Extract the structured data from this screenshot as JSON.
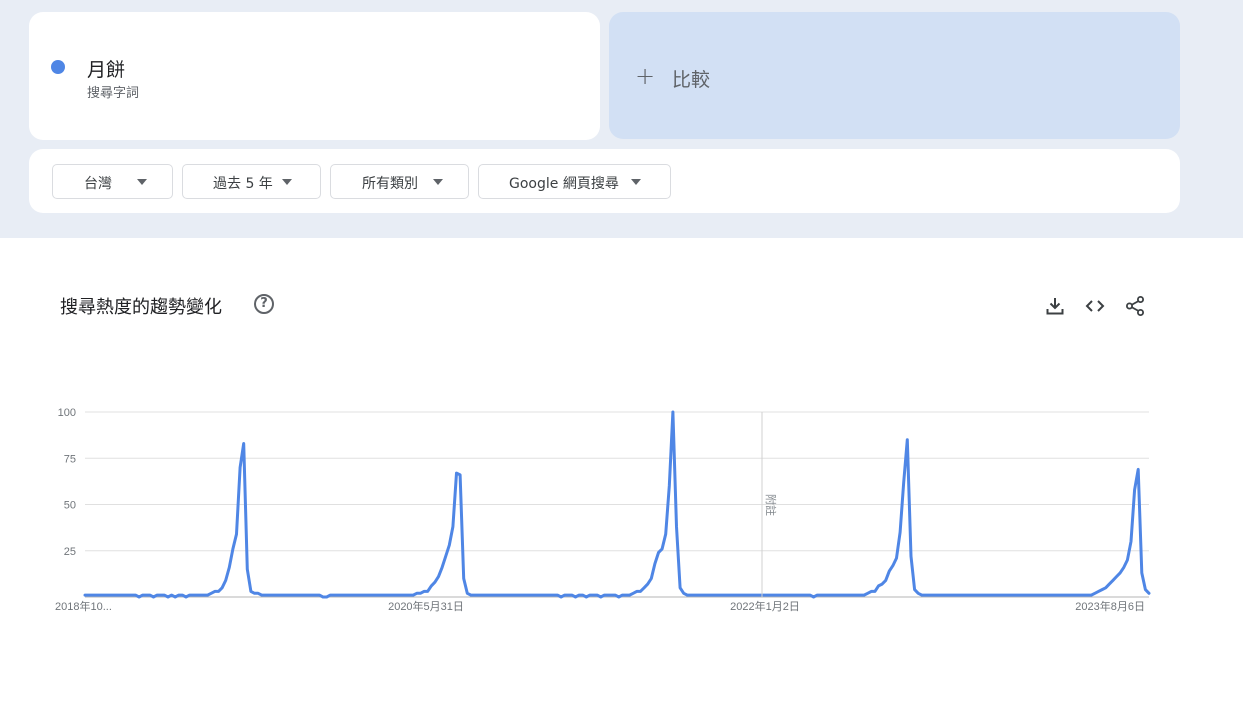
{
  "search_term": {
    "name": "月餅",
    "type": "搜尋字詞",
    "color": "#4f86e5"
  },
  "compare": {
    "label": "比較",
    "bg_color": "#d2e0f4"
  },
  "filters": [
    {
      "label": "台灣"
    },
    {
      "label": "過去 5 年"
    },
    {
      "label": "所有類別"
    },
    {
      "label": "Google 網頁搜尋"
    }
  ],
  "chart_section": {
    "title": "搜尋熱度的趨勢變化",
    "help_icon": "help-circle-icon",
    "actions": [
      "download-icon",
      "embed-code-icon",
      "share-icon"
    ]
  },
  "chart_data": {
    "type": "line",
    "series": [
      {
        "color": "#4f86e5",
        "values": [
          1,
          1,
          1,
          1,
          1,
          1,
          1,
          1,
          1,
          1,
          1,
          1,
          1,
          1,
          1,
          0,
          1,
          1,
          1,
          0,
          1,
          1,
          1,
          0,
          1,
          0,
          1,
          1,
          0,
          1,
          1,
          1,
          1,
          1,
          1,
          2,
          3,
          3,
          5,
          9,
          16,
          26,
          34,
          70,
          83,
          15,
          3,
          2,
          2,
          1,
          1,
          1,
          1,
          1,
          1,
          1,
          1,
          1,
          1,
          1,
          1,
          1,
          1,
          1,
          1,
          1,
          0,
          0,
          1,
          1,
          1,
          1,
          1,
          1,
          1,
          1,
          1,
          1,
          1,
          1,
          1,
          1,
          1,
          1,
          1,
          1,
          1,
          1,
          1,
          1,
          1,
          1,
          2,
          2,
          3,
          3,
          6,
          8,
          11,
          16,
          22,
          28,
          38,
          67,
          66,
          10,
          2,
          1,
          1,
          1,
          1,
          1,
          1,
          1,
          1,
          1,
          1,
          1,
          1,
          1,
          1,
          1,
          1,
          1,
          1,
          1,
          1,
          1,
          1,
          1,
          1,
          1,
          0,
          1,
          1,
          1,
          0,
          1,
          1,
          0,
          1,
          1,
          1,
          0,
          1,
          1,
          1,
          1,
          0,
          1,
          1,
          1,
          2,
          3,
          3,
          5,
          7,
          10,
          18,
          24,
          26,
          34,
          60,
          100,
          38,
          5,
          2,
          1,
          1,
          1,
          1,
          1,
          1,
          1,
          1,
          1,
          1,
          1,
          1,
          1,
          1,
          1,
          1,
          1,
          1,
          1,
          1,
          1,
          1,
          1,
          1,
          1,
          1,
          1,
          1,
          1,
          1,
          1,
          1,
          1,
          1,
          1,
          0,
          1,
          1,
          1,
          1,
          1,
          1,
          1,
          1,
          1,
          1,
          1,
          1,
          1,
          1,
          2,
          3,
          3,
          6,
          7,
          9,
          14,
          17,
          21,
          35,
          62,
          85,
          22,
          4,
          2,
          1,
          1,
          1,
          1,
          1,
          1,
          1,
          1,
          1,
          1,
          1,
          1,
          1,
          1,
          1,
          1,
          1,
          1,
          1,
          1,
          1,
          1,
          1,
          1,
          1,
          1,
          1,
          1,
          1,
          1,
          1,
          1,
          1,
          1,
          1,
          1,
          1,
          1,
          1,
          1,
          1,
          1,
          1,
          1,
          1,
          1,
          1,
          1,
          2,
          3,
          4,
          5,
          7,
          9,
          11,
          13,
          16,
          20,
          30,
          58,
          69,
          13,
          4,
          2
        ]
      }
    ],
    "x_tick_labels": [
      "2018年10...",
      "2020年5月31日",
      "2022年1月2日",
      "2023年8月6日"
    ],
    "y_tick_labels": [
      "100",
      "75",
      "50",
      "25"
    ],
    "ylim": [
      0,
      100
    ],
    "annotation": "附註",
    "grid": true
  }
}
